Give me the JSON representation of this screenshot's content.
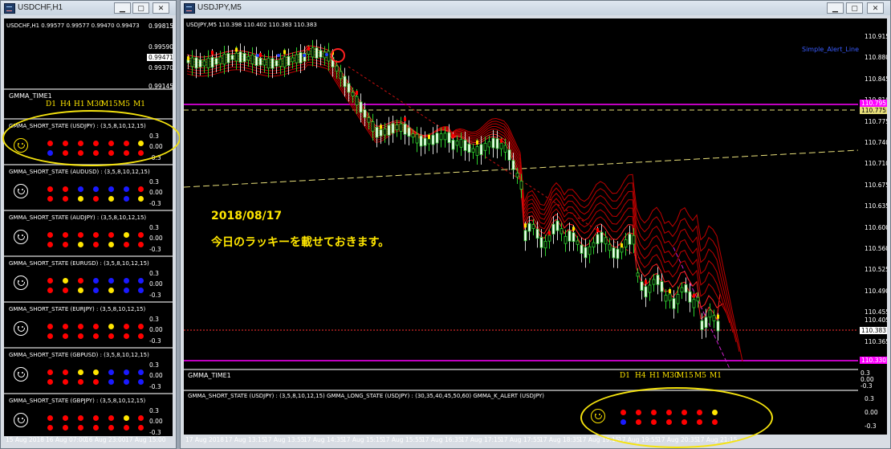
{
  "left_window": {
    "title": "USDCHF,H1",
    "buttons": {
      "minimize": "▁",
      "restore": "▢",
      "close": "✕"
    },
    "chart_header": "USDCHF,H1  0.99577 0.99577 0.99470 0.99473",
    "price_labels": [
      "0.99815",
      "0.99590",
      "0.99471",
      "0.99370",
      "0.99145"
    ],
    "time_panel": {
      "title": "GMMA_TIME1",
      "timeframes": [
        "D1",
        "H4",
        "H1",
        "M30",
        "M15",
        "M5",
        "M1"
      ]
    },
    "indicator_axis": [
      "0.3",
      "0.00",
      "-0.3"
    ],
    "panels": [
      {
        "title": "GMMA_SHORT_STATE (USDJPY) : (3,5,8,10,12,15)",
        "smiley_color": "#ffe600",
        "row1": [
          "red",
          "red",
          "red",
          "red",
          "red",
          "red",
          "yellow"
        ],
        "row2": [
          "blue",
          "red",
          "red",
          "red",
          "red",
          "red",
          "red"
        ]
      },
      {
        "title": "GMMA_SHORT_STATE (AUDUSD) : (3,5,8,10,12,15)",
        "smiley_color": "#ffffff",
        "row1": [
          "red",
          "red",
          "blue",
          "blue",
          "blue",
          "blue",
          "red"
        ],
        "row2": [
          "red",
          "red",
          "yellow",
          "red",
          "yellow",
          "blue",
          "yellow"
        ]
      },
      {
        "title": "GMMA_SHORT_STATE (AUDJPY) : (3,5,8,10,12,15)",
        "smiley_color": "#ffffff",
        "row1": [
          "red",
          "red",
          "red",
          "red",
          "red",
          "yellow",
          "red"
        ],
        "row2": [
          "red",
          "red",
          "yellow",
          "red",
          "yellow",
          "red",
          "red"
        ]
      },
      {
        "title": "GMMA_SHORT_STATE (EURUSD) : (3,5,8,10,12,15)",
        "smiley_color": "#ffffff",
        "row1": [
          "red",
          "yellow",
          "red",
          "blue",
          "blue",
          "blue",
          "blue"
        ],
        "row2": [
          "red",
          "red",
          "yellow",
          "blue",
          "yellow",
          "blue",
          "blue"
        ]
      },
      {
        "title": "GMMA_SHORT_STATE (EURJPY) : (3,5,8,10,12,15)",
        "smiley_color": "#ffffff",
        "row1": [
          "red",
          "red",
          "red",
          "red",
          "yellow",
          "red",
          "red"
        ],
        "row2": [
          "red",
          "red",
          "red",
          "red",
          "red",
          "red",
          "red"
        ]
      },
      {
        "title": "GMMA_SHORT_STATE (GBPUSD) : (3,5,8,10,12,15)",
        "smiley_color": "#ffffff",
        "row1": [
          "red",
          "red",
          "yellow",
          "yellow",
          "blue",
          "blue",
          "blue"
        ],
        "row2": [
          "red",
          "red",
          "red",
          "red",
          "blue",
          "blue",
          "blue"
        ]
      },
      {
        "title": "GMMA_SHORT_STATE (GBPJPY) : (3,5,8,10,12,15)",
        "smiley_color": "#ffffff",
        "row1": [
          "red",
          "red",
          "red",
          "red",
          "red",
          "yellow",
          "red"
        ],
        "row2": [
          "red",
          "red",
          "red",
          "red",
          "red",
          "red",
          "red"
        ]
      }
    ],
    "time_axis": [
      "15 Aug 2018",
      "16 Aug 07:00",
      "16 Aug 23:00",
      "17 Aug 15:00"
    ]
  },
  "main_window": {
    "title": "USDJPY,M5",
    "buttons": {
      "minimize": "▁",
      "restore": "▢",
      "close": "✕"
    },
    "chart_header": "USDJPY,M5  110.398 110.402 110.383 110.383",
    "alert_label": "Simple_Alert_Line",
    "price_labels": [
      "110.915",
      "110.880",
      "110.845",
      "110.810",
      "110.775",
      "110.740",
      "110.710",
      "110.675",
      "110.635",
      "110.600",
      "110.560",
      "110.525",
      "110.490",
      "110.455",
      "110.405",
      "110.365",
      "110.330"
    ],
    "price_boxes": {
      "upper_magenta": "110.795",
      "upper_yellow": "110.775",
      "current": "110.383",
      "lower_magenta": "110.330"
    },
    "annotation": {
      "date": "2018/08/17",
      "text": "今日のラッキーを載せておきます。"
    },
    "time_panel": {
      "title": "GMMA_TIME1",
      "timeframes": [
        "D1",
        "H4",
        "H1",
        "M30",
        "M15",
        "M5",
        "M1"
      ],
      "axis": [
        "0.3",
        "0.00",
        "-0.3"
      ]
    },
    "state_panel": {
      "title": "GMMA_SHORT_STATE (USDJPY) : (3,5,8,10,12,15)  GMMA_LONG_STATE (USDJPY) : (30,35,40,45,50,60)  GMMA_K_ALERT (USDJPY)",
      "smiley_color": "#ffe600",
      "row1": [
        "red",
        "red",
        "red",
        "red",
        "red",
        "red",
        "yellow"
      ],
      "row2": [
        "blue",
        "red",
        "red",
        "red",
        "red",
        "red",
        "red"
      ],
      "axis": [
        "0.3",
        "0.00",
        "-0.3"
      ]
    },
    "time_axis": [
      "17 Aug 2018",
      "17 Aug 13:15",
      "17 Aug 13:55",
      "17 Aug 14:35",
      "17 Aug 15:15",
      "17 Aug 15:55",
      "17 Aug 16:35",
      "17 Aug 17:15",
      "17 Aug 17:55",
      "17 Aug 18:35",
      "17 Aug 19:15",
      "17 Aug 19:55",
      "17 Aug 20:35",
      "17 Aug 21:15"
    ]
  },
  "colors": {
    "red": "#ff0000",
    "blue": "#1a1aff",
    "yellow": "#ffe600",
    "magenta": "#ff00ff",
    "highlight": "#f5e30e"
  }
}
